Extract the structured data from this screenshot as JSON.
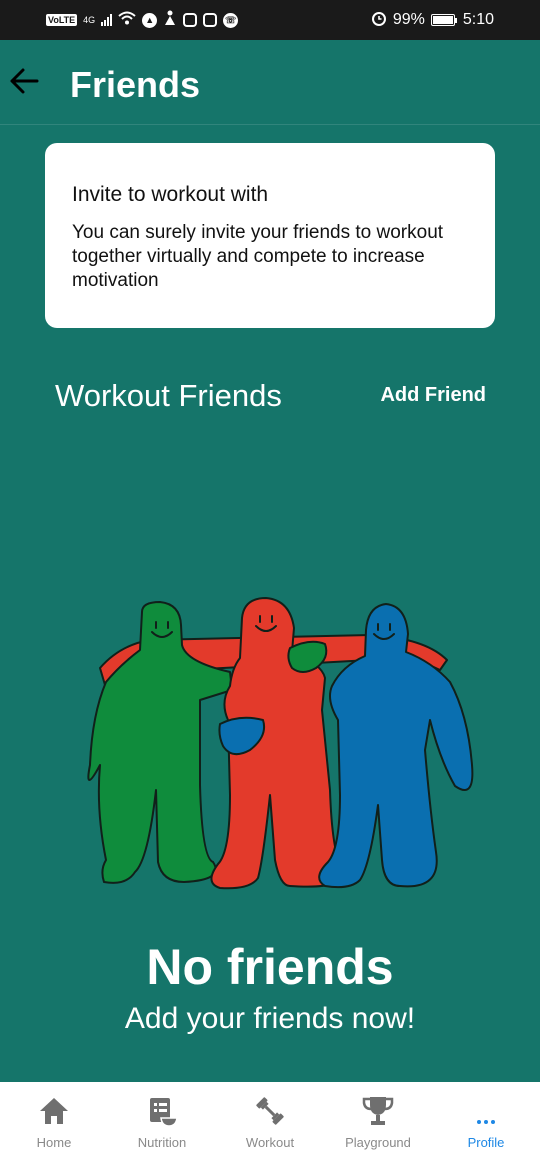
{
  "status_bar": {
    "network": "4G",
    "volte": "VoLTE",
    "battery": "99%",
    "time": "5:10"
  },
  "app_bar": {
    "title": "Friends"
  },
  "invite_card": {
    "title": "Invite to workout with",
    "text": "You can surely invite your friends to workout together virtually and compete to increase motivation"
  },
  "friends_section": {
    "title": "Workout Friends",
    "add_label": "Add Friend"
  },
  "empty_state": {
    "title": "No friends",
    "subtitle": "Add your friends now!"
  },
  "bottom_nav": {
    "items": [
      {
        "label": "Home",
        "icon": "home-icon"
      },
      {
        "label": "Nutrition",
        "icon": "nutrition-icon"
      },
      {
        "label": "Workout",
        "icon": "dumbbell-icon"
      },
      {
        "label": "Playground",
        "icon": "trophy-icon"
      },
      {
        "label": "Profile",
        "icon": "more-dots-icon"
      }
    ],
    "active": "Profile"
  },
  "colors": {
    "background": "#15756a",
    "status_bar": "#1a1a1a",
    "accent": "#1e88e5",
    "figure_green": "#0f8c3c",
    "figure_red": "#e33a2b",
    "figure_blue": "#0a6fb0"
  }
}
